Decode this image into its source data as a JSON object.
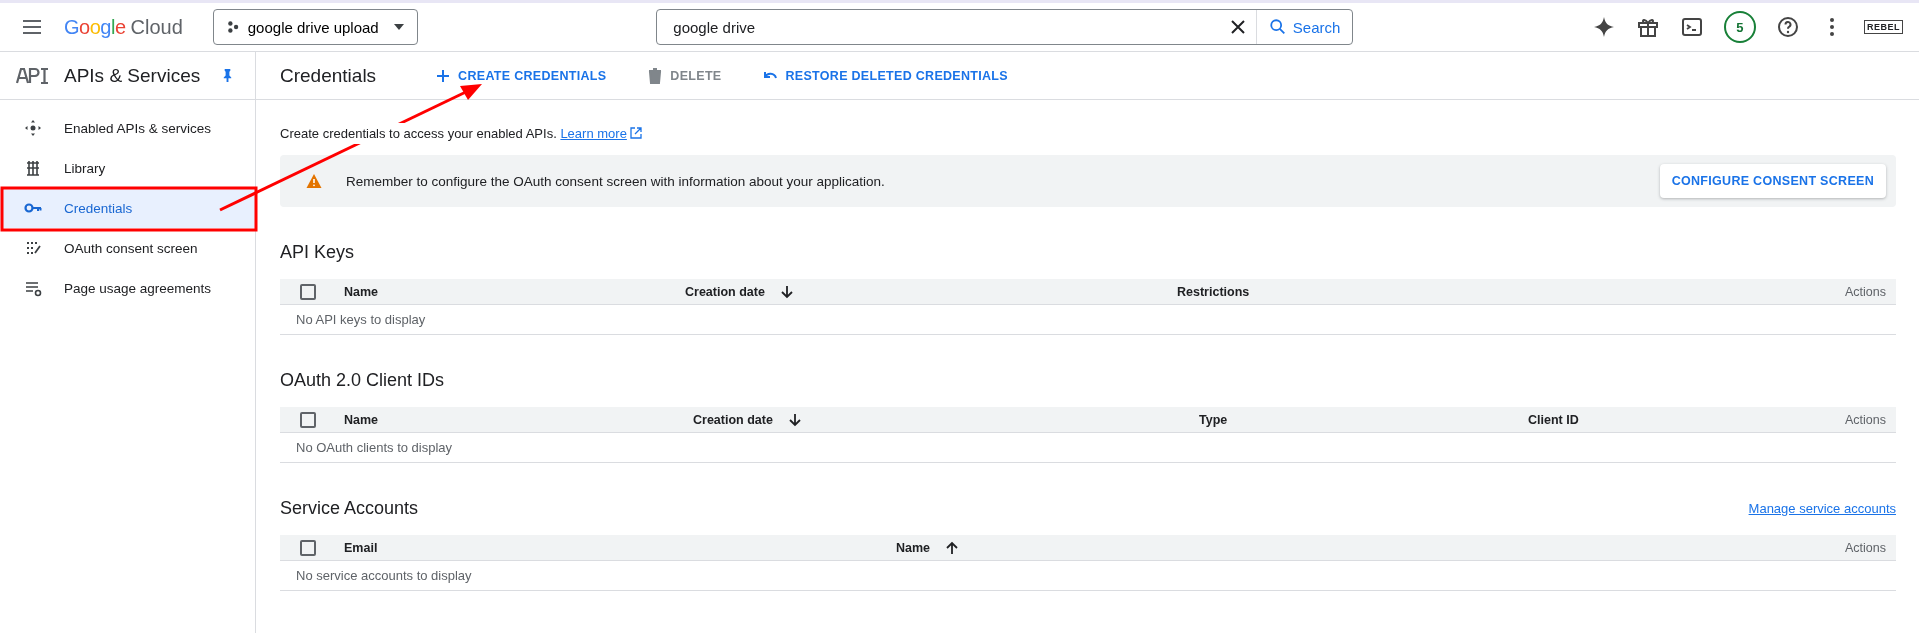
{
  "top_bar": {
    "logo": {
      "brand": "Google",
      "product": "Cloud"
    },
    "project": "google drive upload",
    "search": {
      "value": "google drive",
      "button": "Search"
    },
    "notifications_count": "5",
    "account_label": "REBEL"
  },
  "sidebar": {
    "title": "APIs & Services",
    "items": [
      {
        "label": "Enabled APIs & services",
        "selected": false
      },
      {
        "label": "Library",
        "selected": false
      },
      {
        "label": "Credentials",
        "selected": true
      },
      {
        "label": "OAuth consent screen",
        "selected": false
      },
      {
        "label": "Page usage agreements",
        "selected": false
      }
    ]
  },
  "page_header": {
    "title": "Credentials",
    "actions": [
      {
        "label": "CREATE CREDENTIALS",
        "kind": "create",
        "disabled": false
      },
      {
        "label": "DELETE",
        "kind": "delete",
        "disabled": true
      },
      {
        "label": "RESTORE DELETED CREDENTIALS",
        "kind": "restore",
        "disabled": false
      }
    ]
  },
  "description": {
    "text": "Create credentials to access your enabled APIs.",
    "link": "Learn more"
  },
  "banner": {
    "message": "Remember to configure the OAuth consent screen with information about your application.",
    "button": "CONFIGURE CONSENT SCREEN"
  },
  "sections": [
    {
      "title": "API Keys",
      "select_all_checked": false,
      "columns": [
        {
          "label": "Name",
          "sorted": false
        },
        {
          "label": "Creation date",
          "sorted": true,
          "ascending": false
        },
        {
          "label": "Restrictions",
          "sorted": false
        },
        {
          "label": "Actions",
          "sorted": false
        }
      ],
      "empty": "No API keys to display"
    },
    {
      "title": "OAuth 2.0 Client IDs",
      "select_all_checked": false,
      "columns": [
        {
          "label": "Name",
          "sorted": false
        },
        {
          "label": "Creation date",
          "sorted": true,
          "ascending": false
        },
        {
          "label": "Type",
          "sorted": false
        },
        {
          "label": "Client ID",
          "sorted": false
        },
        {
          "label": "Actions",
          "sorted": false
        }
      ],
      "empty": "No OAuth clients to display"
    },
    {
      "title": "Service Accounts",
      "link": "Manage service accounts",
      "select_all_checked": false,
      "columns": [
        {
          "label": "Email",
          "sorted": false
        },
        {
          "label": "Name",
          "sorted": true,
          "ascending": true
        },
        {
          "label": "Actions",
          "sorted": false
        }
      ],
      "empty": "No service accounts to display"
    }
  ]
}
